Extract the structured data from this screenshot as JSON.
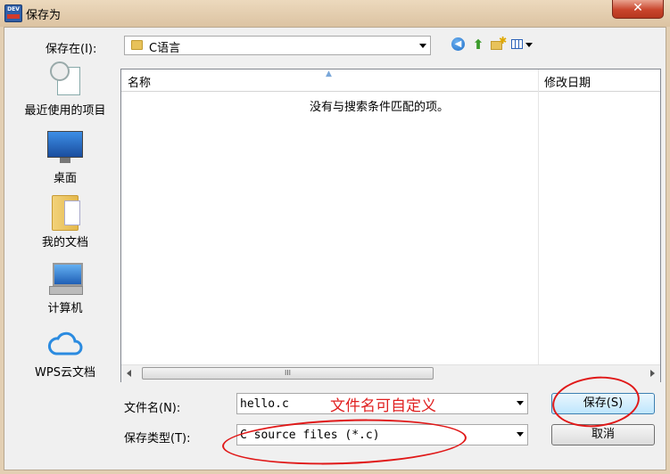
{
  "window": {
    "title": "保存为",
    "app_icon_text": "DEV",
    "close_label": "✕"
  },
  "toolbar": {
    "save_in_label": "保存在(I):",
    "save_in_value": "C语言",
    "back_icon": "back-icon",
    "up_icon": "up-folder-icon",
    "new_folder_icon": "new-folder-icon",
    "view_icon": "view-menu-icon"
  },
  "places": [
    {
      "label": "最近使用的项目",
      "icon": "recent-items-icon"
    },
    {
      "label": "桌面",
      "icon": "desktop-icon"
    },
    {
      "label": "我的文档",
      "icon": "documents-icon"
    },
    {
      "label": "计算机",
      "icon": "computer-icon"
    },
    {
      "label": "WPS云文档",
      "icon": "cloud-icon"
    }
  ],
  "file_list": {
    "columns": [
      "名称",
      "修改日期"
    ],
    "empty_message": "没有与搜索条件匹配的项。",
    "scroll_grip": "III"
  },
  "form": {
    "filename_label": "文件名(N):",
    "filename_value": "hello.c",
    "filetype_label": "保存类型(T):",
    "filetype_value": "C source files (*.c)",
    "save_button": "保存(S)",
    "cancel_button": "取消"
  },
  "annotation": {
    "text": "文件名可自定义",
    "color": "#e02020"
  }
}
